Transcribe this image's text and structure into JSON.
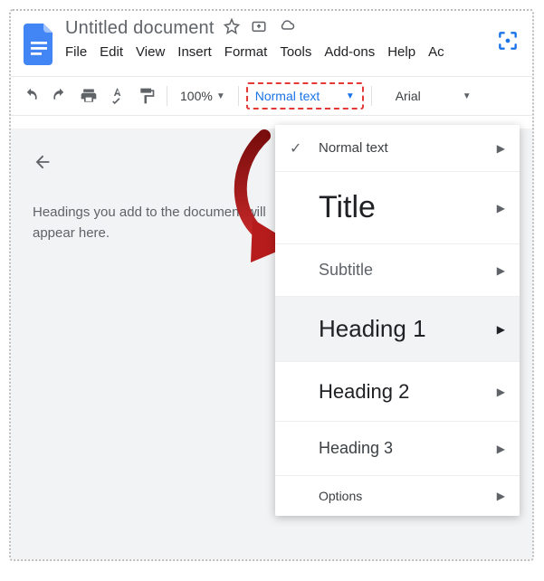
{
  "header": {
    "title": "Untitled document"
  },
  "menu": {
    "file": "File",
    "edit": "Edit",
    "view": "View",
    "insert": "Insert",
    "format": "Format",
    "tools": "Tools",
    "addons": "Add-ons",
    "help": "Help",
    "accessibility": "Ac"
  },
  "toolbar": {
    "zoom": "100%",
    "styles_label": "Normal text",
    "font": "Arial"
  },
  "outline": {
    "text1": "Headings you add to the document will",
    "text2": "appear here."
  },
  "styles_menu": {
    "normal": "Normal text",
    "title": "Title",
    "subtitle": "Subtitle",
    "h1": "Heading 1",
    "h2": "Heading 2",
    "h3": "Heading 3",
    "options": "Options"
  }
}
